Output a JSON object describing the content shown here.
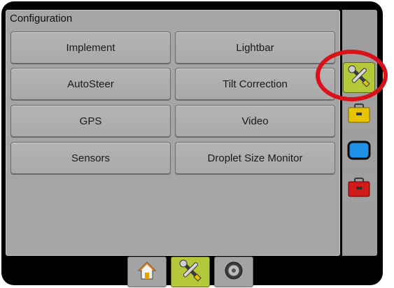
{
  "panel": {
    "title": "Configuration",
    "buttons": [
      {
        "label": "Implement"
      },
      {
        "label": "Lightbar"
      },
      {
        "label": "AutoSteer"
      },
      {
        "label": "Tilt Correction"
      },
      {
        "label": "GPS"
      },
      {
        "label": "Video"
      },
      {
        "label": "Sensors"
      },
      {
        "label": "Droplet Size Monitor"
      }
    ]
  },
  "side_tabs": [
    {
      "icon": "wrench-screwdriver-icon",
      "active": true
    },
    {
      "icon": "toolbox-icon",
      "color": "#e8c400"
    },
    {
      "icon": "display-icon",
      "color": "#1e90e6"
    },
    {
      "icon": "red-toolbox-icon",
      "color": "#d21a1a"
    }
  ],
  "bottom_tabs": [
    {
      "icon": "home-icon"
    },
    {
      "icon": "wrench-screwdriver-icon",
      "active": true
    },
    {
      "icon": "gauge-icon"
    }
  ],
  "colors": {
    "active_tab": "#b5c83a",
    "highlight": "#d8111b"
  }
}
